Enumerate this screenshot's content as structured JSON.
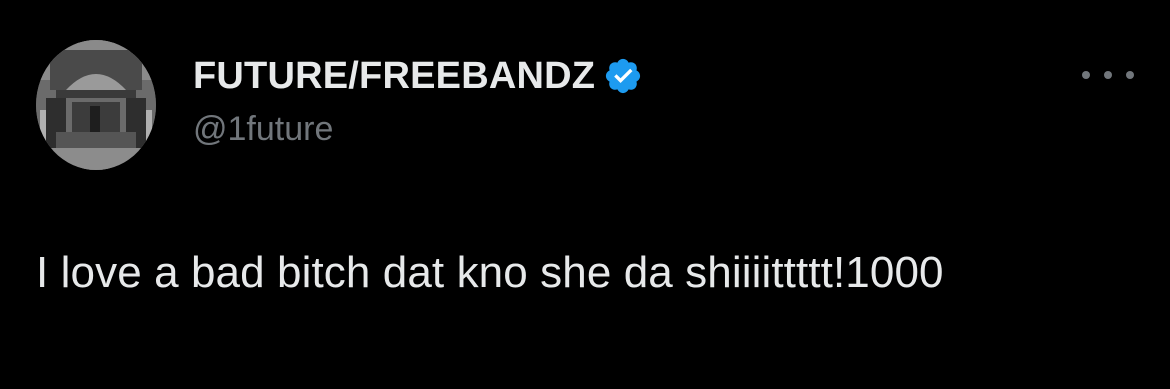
{
  "tweet": {
    "author": {
      "display_name": "FUTURE/FREEBANDZ",
      "handle": "@1future",
      "verified": true,
      "verified_color": "#1d9bf0",
      "avatar_icon": "avatar"
    },
    "text": "I love a bad bitch dat kno she da shiiiittttt!1000",
    "more_icon": "more-options-icon"
  },
  "colors": {
    "background": "#000000",
    "primary_text": "#e7e9ea",
    "secondary_text": "#71767b"
  }
}
